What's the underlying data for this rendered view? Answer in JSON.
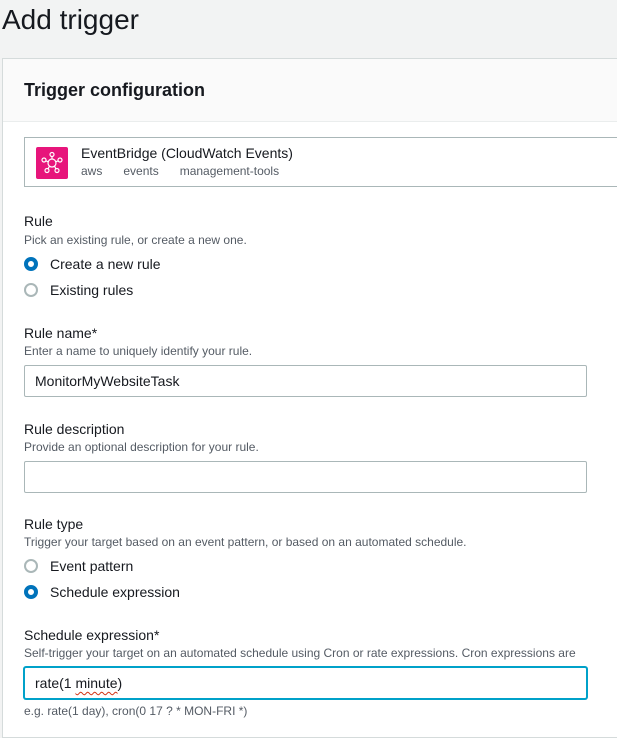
{
  "page": {
    "title": "Add trigger"
  },
  "panel": {
    "title": "Trigger configuration"
  },
  "service": {
    "name": "EventBridge (CloudWatch Events)",
    "tags": [
      "aws",
      "events",
      "management-tools"
    ],
    "icon": "eventbridge-icon",
    "icon_color": "#e7157b"
  },
  "rule": {
    "label": "Rule",
    "description": "Pick an existing rule, or create a new one.",
    "options": [
      {
        "label": "Create a new rule",
        "checked": true
      },
      {
        "label": "Existing rules",
        "checked": false
      }
    ]
  },
  "rule_name": {
    "label": "Rule name*",
    "description": "Enter a name to uniquely identify your rule.",
    "value": "MonitorMyWebsiteTask"
  },
  "rule_description": {
    "label": "Rule description",
    "description": "Provide an optional description for your rule.",
    "value": ""
  },
  "rule_type": {
    "label": "Rule type",
    "description": "Trigger your target based on an event pattern, or based on an automated schedule.",
    "options": [
      {
        "label": "Event pattern",
        "checked": false
      },
      {
        "label": "Schedule expression",
        "checked": true
      }
    ]
  },
  "schedule_expression": {
    "label": "Schedule expression*",
    "description": "Self-trigger your target on an automated schedule using Cron or rate expressions. Cron expressions are",
    "value_prefix": "rate(1 ",
    "value_misspelled": "minute",
    "value_suffix": ")",
    "hint": "e.g. rate(1 day), cron(0 17 ? * MON-FRI *)"
  },
  "colors": {
    "accent": "#0073bb",
    "focus": "#00a1c9",
    "spellcheck": "#d13212"
  }
}
